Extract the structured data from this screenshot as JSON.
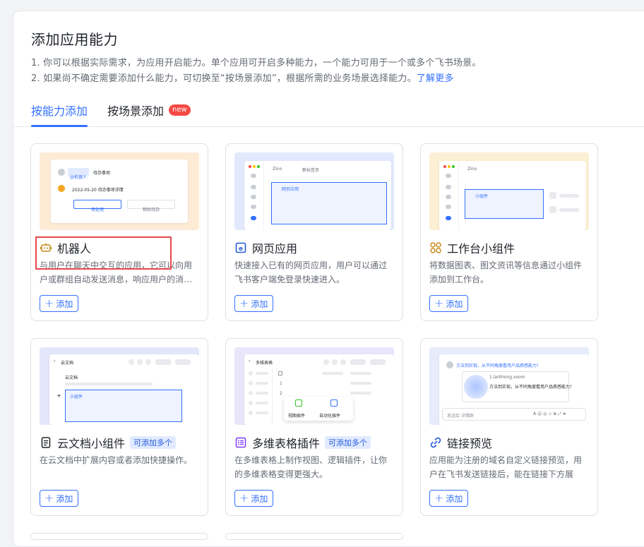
{
  "page": {
    "title": "添加应用能力",
    "desc1": "1. 你可以根据实际需求，为应用开启能力。单个应用可开启多种能力，一个能力可用于一个或多个飞书场景。",
    "desc2_prefix": "2. 如果尚不确定需要添加什么能力，可切换至“按场景添加”，根据所需的业务场景选择能力。",
    "desc2_link": "了解更多"
  },
  "tabs": {
    "by_ability": "按能力添加",
    "by_scene": "按场景添加",
    "new_badge": "new"
  },
  "add_label": "添加",
  "cards": [
    {
      "name": "机器人",
      "desc": "与用户在聊天中交互的应用，它可以向用户或群组自动发送消息，响应用户的消…",
      "tag": "",
      "preview": {
        "chip": "@机器人",
        "task": "待办事项",
        "date_line": "2022-05-20 待办事项详情",
        "btn1": "去处理",
        "btn2": "稍后待办"
      }
    },
    {
      "name": "网页应用",
      "desc": "快速接入已有的网页应用，用户可以通过飞书客户端免登录快速进入。",
      "tag": "",
      "preview": {
        "tab1": "Zino",
        "tab2": "新标签页",
        "box": "网页应用"
      }
    },
    {
      "name": "工作台小组件",
      "desc": "将数据图表、图文资讯等信息通过小组件添加到工作台。",
      "tag": "",
      "preview": {
        "tab1": "Zino",
        "box": "小组件"
      }
    },
    {
      "name": "云文档小组件",
      "desc": "在云文档中扩展内容或者添加快捷操作。",
      "tag": "可添加多个",
      "preview": {
        "header": "云文档",
        "doc_title": "云文档",
        "box": "小组件"
      }
    },
    {
      "name": "多维表格插件",
      "desc": "在多维表格上制作视图、逻辑插件，让你的多维表格变得更强大。",
      "tag": "可添加多个",
      "preview": {
        "header": "多维表格",
        "row1": "1",
        "row2": "2",
        "plugin1": "视图插件",
        "plugin2": "自动化插件"
      }
    },
    {
      "name": "链接预览",
      "desc": "应用能为注册的域名自定义链接预览，用户在飞书发送链接后，能在链接下方展示…",
      "tag": "",
      "preview": {
        "msg": "方法到实现，从不同角度看用户品质感能力！",
        "link": "1.larkhong.xxom",
        "card_text": "方法到实现，从不同角度看用户品质感能力！",
        "input": "发送给 详情群"
      }
    }
  ],
  "colors": {
    "primary": "#3370ff",
    "badge_red": "#f54a45",
    "highlight_red": "#e5484d"
  }
}
